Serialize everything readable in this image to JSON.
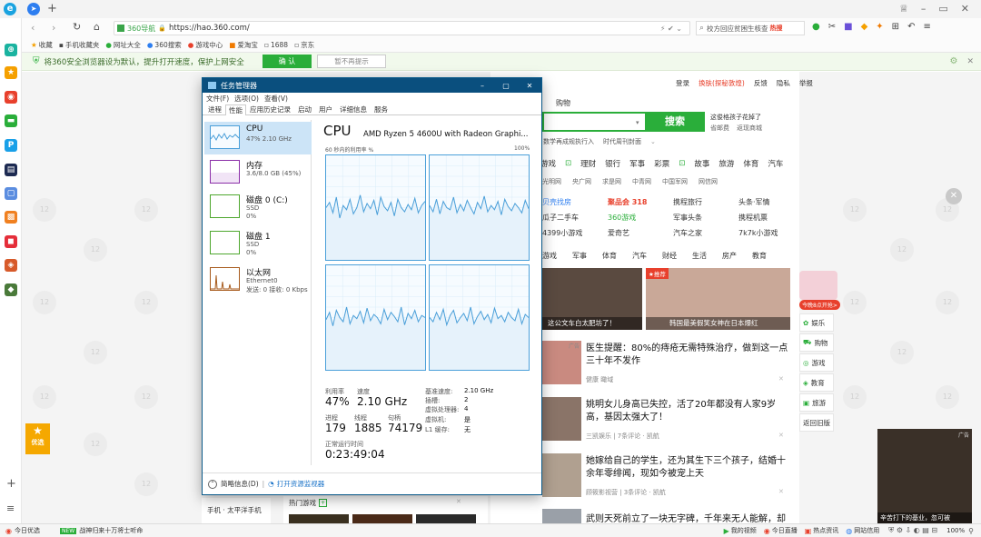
{
  "browser": {
    "url_badge": "360导航",
    "url": "https://hao.360.com/",
    "search_placeholder": "校方回应贫困生核查",
    "search_hot": "热搜",
    "bookmarks": [
      "收藏",
      "手机收藏夹",
      "网址大全",
      "360搜索",
      "游戏中心",
      "爱淘宝",
      "1688",
      "京东"
    ],
    "notice_text": "将360安全浏览器设为默认，提升打开速度，保护上网安全",
    "notice_confirm": "确 认",
    "notice_dismiss": "暂不再提示"
  },
  "page": {
    "top_links": [
      "登录",
      "换肤(探秘敦煌)",
      "反馈",
      "隐私",
      "举报"
    ],
    "search_tab": "购物",
    "search_button": "搜索",
    "search_hint": "这俊格孩子花掉了",
    "search_links": [
      "省邮费",
      "返现商城"
    ],
    "search_sub": [
      "数学再成规执行入",
      "时代周刊封面"
    ],
    "nav": [
      "游戏",
      "理财",
      "银行",
      "军事",
      "彩票",
      "故事",
      "旅游",
      "体育",
      "汽车"
    ],
    "nav2": [
      "光明网",
      "央广网",
      "求是网",
      "中青网",
      "中国军网",
      "网信网"
    ],
    "links_grid": [
      [
        "贝壳找房",
        "聚品会 318",
        "携程旅行",
        "头条·军情"
      ],
      [
        "瓜子二手车",
        "360游戏",
        "军事头条",
        "携程机票"
      ],
      [
        "4399小游戏",
        "爱奇艺",
        "汽车之家",
        "7k7k小游戏"
      ]
    ],
    "news_tabs": [
      "游戏",
      "军事",
      "体育",
      "汽车",
      "财经",
      "生活",
      "房产",
      "教育"
    ],
    "img_caption_1": "这公文车白太肥坊了！",
    "img_badge_2": "★推荐",
    "img_caption_2": "韩国最美假笑女神在日本爆红",
    "news": [
      {
        "title": "医生提醒：80%的痔疮无需特殊治疗，做到这一点三十年不发作",
        "meta": "健康  瞰域",
        "badge": "广告"
      },
      {
        "title": "姚明女儿身高已失控，活了20年都没有人家9岁高，基因太强大了！",
        "meta": "三凯娱乐  | 7条评论 · 凯航"
      },
      {
        "title": "她嫁给自己的学生，还为其生下三个孩子，结婚十余年零绯闻，现如今被宠上天",
        "meta": "顾筱影视营  | 3条评论 · 凯航"
      },
      {
        "title": "武则天死前立了一块无字碑，千年来无人能解，却被",
        "meta": ""
      }
    ],
    "side_menu": [
      "娱乐",
      "购物",
      "游戏",
      "教育",
      "旅游",
      "返回旧版"
    ],
    "promo_bubble": "今晚8点开抢>",
    "bottom_games": "热门游戏",
    "bottom_left": "手机 · 太平洋手机",
    "left_promo": "优选",
    "ad_badge": "广告",
    "ad_caption": "辛苦打下的基业，忽可被"
  },
  "status": {
    "left": [
      "今日优选",
      "战神归来十万将士听命"
    ],
    "right": [
      "我的视频",
      "今日直播",
      "热点资讯",
      "网站信用"
    ],
    "zoom": "100%"
  },
  "taskmgr": {
    "title": "任务管理器",
    "menu": [
      "文件(F)",
      "选项(O)",
      "查看(V)"
    ],
    "tabs": [
      "进程",
      "性能",
      "应用历史记录",
      "启动",
      "用户",
      "详细信息",
      "服务"
    ],
    "active_tab": "性能",
    "side": [
      {
        "name": "CPU",
        "sub1": "47% 2.10 GHz",
        "sub2": "",
        "color": "#4a9fd9"
      },
      {
        "name": "内存",
        "sub1": "3.6/8.0 GB (45%)",
        "sub2": "",
        "color": "#8b2fa8"
      },
      {
        "name": "磁盘 0 (C:)",
        "sub1": "SSD",
        "sub2": "0%",
        "color": "#4ea72e"
      },
      {
        "name": "磁盘 1",
        "sub1": "SSD",
        "sub2": "0%",
        "color": "#4ea72e"
      },
      {
        "name": "以太网",
        "sub1": "Ethernet0",
        "sub2": "发送: 0 接收: 0 Kbps",
        "color": "#a75a1c"
      }
    ],
    "cpu_title": "CPU",
    "cpu_model": "AMD Ryzen 5 4600U with Radeon Graphi...",
    "util_label": "60 秒内的利用率 %",
    "util_max": "100%",
    "stats": {
      "util_label": "利用率",
      "util_value": "47%",
      "speed_label": "速度",
      "speed_value": "2.10 GHz",
      "proc_label": "进程",
      "proc_value": "179",
      "thread_label": "线程",
      "thread_value": "1885",
      "handle_label": "句柄",
      "handle_value": "74179",
      "uptime_label": "正常运行时间",
      "uptime_value": "0:23:49:04"
    },
    "kv": [
      {
        "k": "基准速度:",
        "v": "2.10 GHz"
      },
      {
        "k": "插槽:",
        "v": "2"
      },
      {
        "k": "虚拟处理器:",
        "v": "4"
      },
      {
        "k": "虚拟机:",
        "v": "是"
      },
      {
        "k": "L1 缓存:",
        "v": "无"
      }
    ],
    "fewer_details": "简略信息(D)",
    "open_resmon": "打开资源监视器",
    "graph_series": [
      [
        50,
        55,
        45,
        60,
        40,
        52,
        48,
        58,
        44,
        50,
        62,
        46,
        54,
        49,
        57,
        43,
        60,
        51,
        47,
        55,
        42,
        58,
        50,
        46,
        53,
        48,
        59,
        45,
        52,
        56
      ],
      [
        52,
        46,
        58,
        44,
        56,
        50,
        48,
        60,
        45,
        53,
        47,
        57,
        50,
        44,
        55,
        49,
        61,
        46,
        52,
        48,
        56,
        43,
        58,
        51,
        47,
        54,
        50,
        45,
        57,
        49
      ],
      [
        48,
        55,
        42,
        57,
        50,
        46,
        60,
        44,
        52,
        49,
        56,
        45,
        59,
        47,
        53,
        50,
        44,
        58,
        48,
        55,
        51,
        46,
        60,
        43,
        54,
        49,
        57,
        46,
        52,
        50
      ],
      [
        50,
        46,
        55,
        48,
        58,
        43,
        52,
        57,
        45,
        50,
        54,
        47,
        60,
        44,
        51,
        56,
        48,
        53,
        45,
        59,
        49,
        52,
        46,
        55,
        50,
        47,
        58,
        44,
        53,
        50
      ]
    ]
  }
}
